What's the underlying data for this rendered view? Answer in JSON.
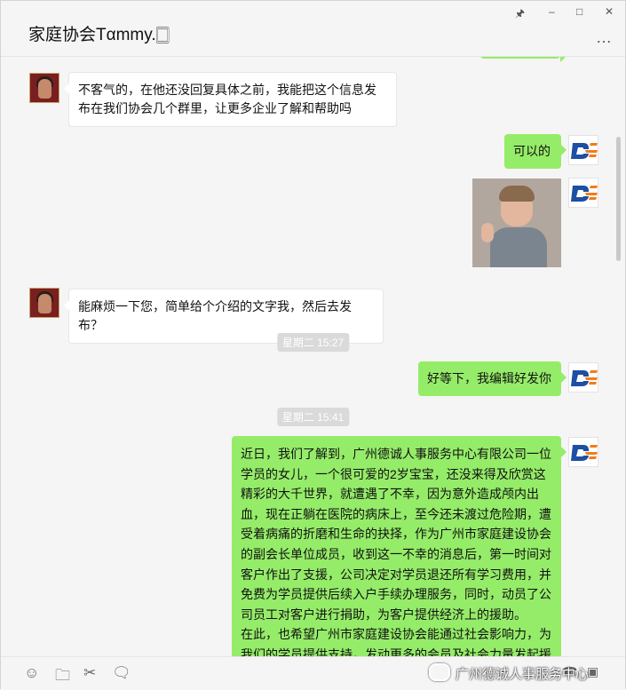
{
  "window": {
    "title": "家庭协会Tαmmy.🀆",
    "controls": [
      "pin-icon",
      "minimize-icon",
      "maximize-icon",
      "close-icon"
    ],
    "more_label": "…"
  },
  "messages": [
    {
      "side": "left",
      "text": "不客气的，在他还没回复具体之前，我能把这个信息发布在我们协会几个群里，让更多企业了解和帮助吗"
    },
    {
      "side": "right",
      "text": "可以的"
    },
    {
      "side": "right",
      "type": "image",
      "image_desc": "boy-thumbs-up-photo"
    },
    {
      "side": "left",
      "text": "能麻烦一下您，简单给个介绍的文字我，然后去发布？"
    },
    {
      "type": "time",
      "text": "星期二 15:27"
    },
    {
      "side": "right",
      "text": "好等下，我编辑好发你"
    },
    {
      "type": "time",
      "text": "星期二 15:41"
    },
    {
      "side": "right",
      "text": "近日，我们了解到，广州德诚人事服务中心有限公司一位学员的女儿，一个很可爱的2岁宝宝，还没来得及欣赏这精彩的大千世界，就遭遇了不幸，因为意外造成颅内出血，现在正躺在医院的病床上，至今还未渡过危险期，遭受着病痛的折磨和生命的抉择，作为广州市家庭建设协会的副会长单位成员，收到这一不幸的消息后，第一时间对客户作出了支援，公司决定对学员退还所有学习费用，并免费为学员提供后续入户手续办理服务，同时，动员了公司员工对客户进行捐助，为客户提供经济上的援助。\n在此，也希望广州市家庭建设协会能通过社会影响力，为我们的学员提供支持，发动更多的会员及社会力量发起援助。"
    }
  ],
  "toolbar": {
    "icons": [
      "emoji-icon",
      "folder-icon",
      "scissors-icon",
      "chat-history-icon",
      "phone-icon",
      "video-icon"
    ],
    "watermark": "广州德诚人事服务中心"
  },
  "colors": {
    "green_bubble": "#95ec69",
    "white_bubble": "#ffffff",
    "logo_blue": "#1d4fa3",
    "logo_orange": "#f07d1a"
  }
}
